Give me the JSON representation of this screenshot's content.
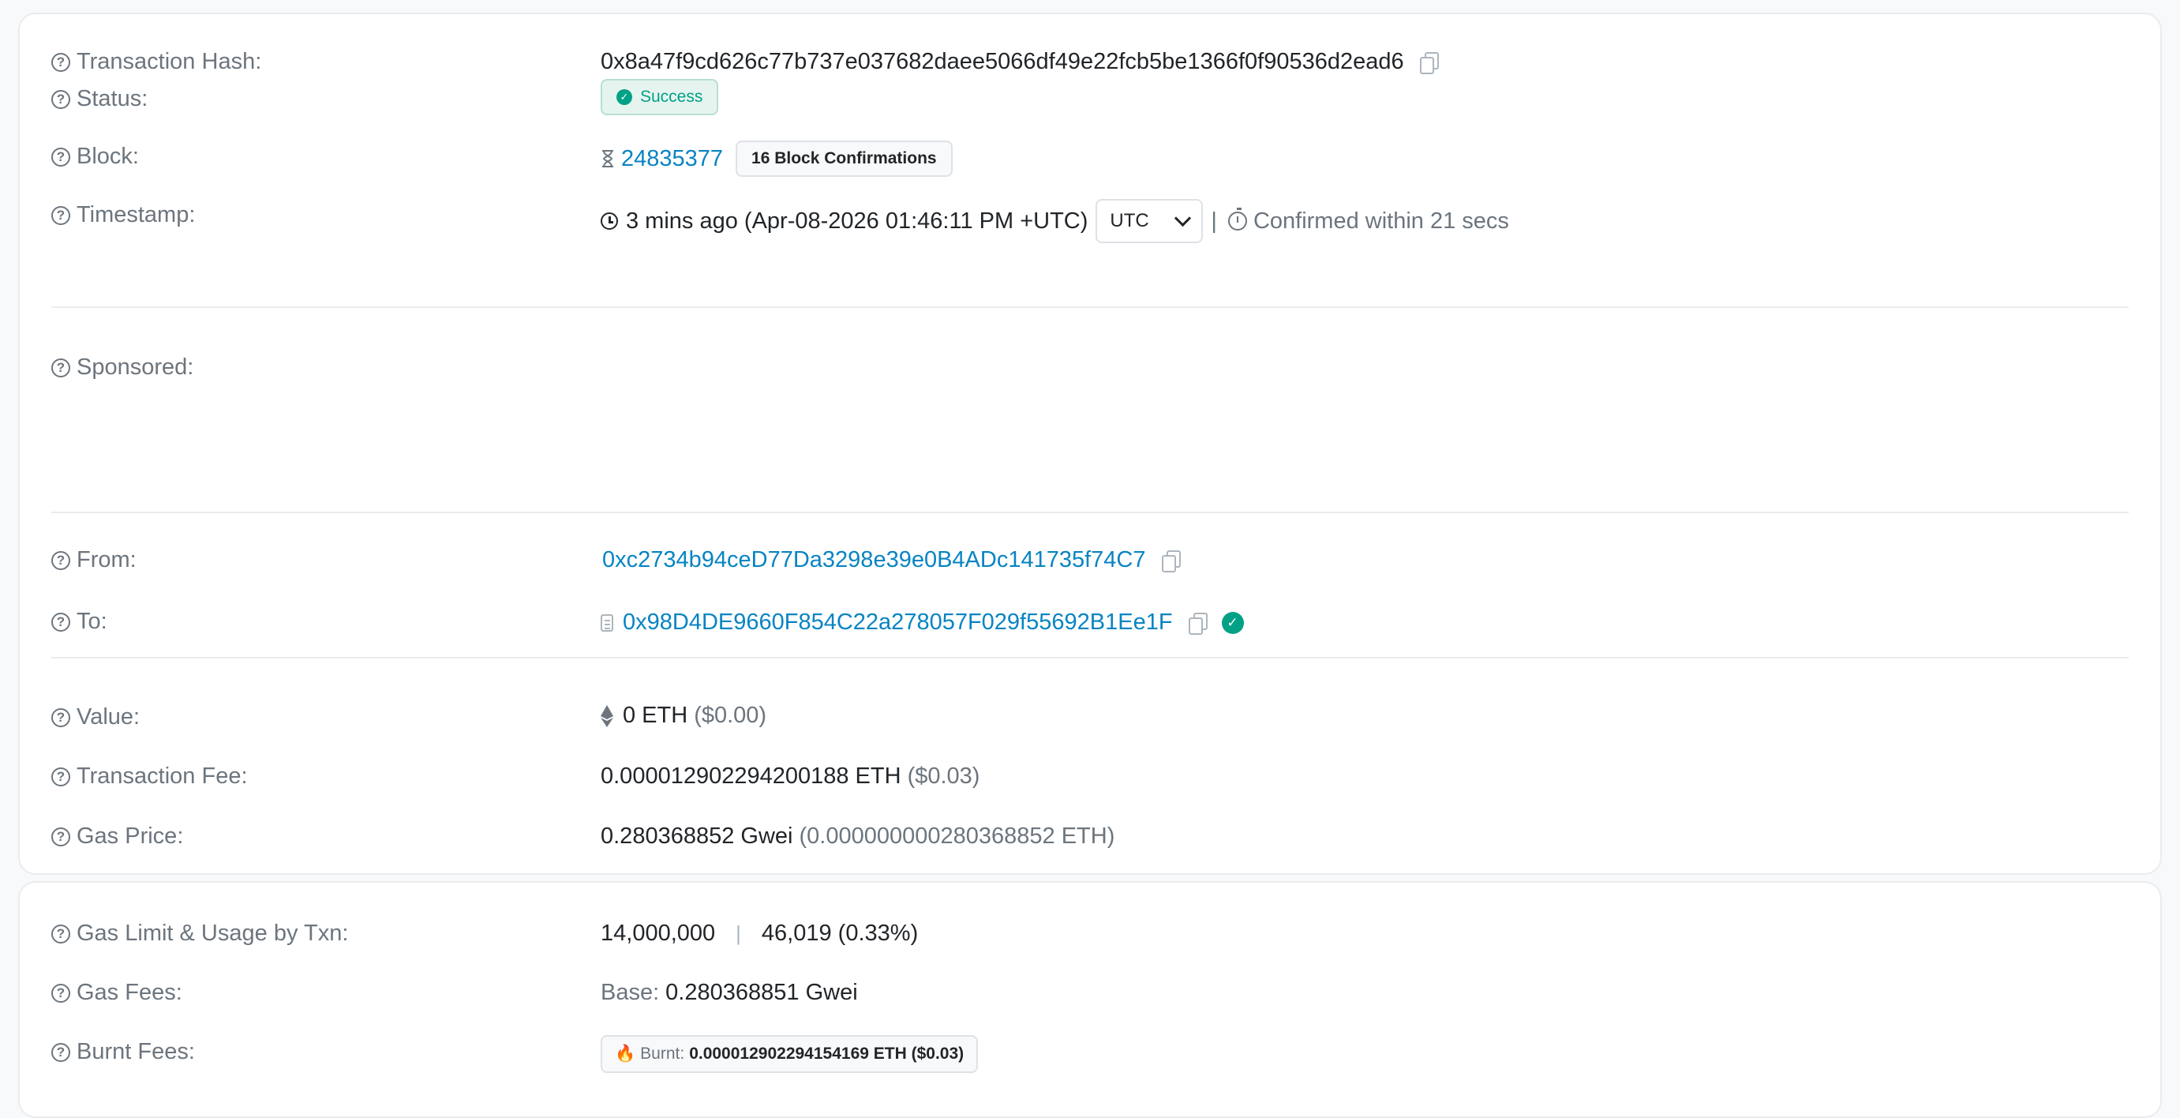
{
  "overview": {
    "tx_hash": {
      "label": "Transaction Hash:",
      "value": "0x8a47f9cd626c77b737e037682daee5066df49e22fcb5be1366f0f90536d2ead6"
    },
    "status": {
      "label": "Status:",
      "value": "Success"
    },
    "block": {
      "label": "Block:",
      "number": "24835377",
      "confirmations": "16 Block Confirmations"
    },
    "timestamp": {
      "label": "Timestamp:",
      "value": "3 mins ago (Apr-08-2026 01:46:11 PM +UTC)",
      "timezone": "UTC",
      "separator": "|",
      "confirmed": "Confirmed within 21 secs"
    },
    "sponsored": {
      "label": "Sponsored:"
    },
    "from": {
      "label": "From:",
      "address": "0xc2734b94ceD77Da3298e39e0B4ADc141735f74C7"
    },
    "to": {
      "label": "To:",
      "address": "0x98D4DE9660F854C22a278057F029f55692B1Ee1F"
    },
    "value": {
      "label": "Value:",
      "amount": "0 ETH",
      "usd": "($0.00)"
    },
    "fee": {
      "label": "Transaction Fee:",
      "amount": "0.000012902294200188 ETH",
      "usd": "($0.03)"
    },
    "gas_price": {
      "label": "Gas Price:",
      "gwei": "0.280368852 Gwei",
      "eth": "(0.000000000280368852 ETH)"
    }
  },
  "gas": {
    "limit_usage": {
      "label": "Gas Limit & Usage by Txn:",
      "limit": "14,000,000",
      "separator": "|",
      "usage": "46,019 (0.33%)"
    },
    "fees": {
      "label": "Gas Fees:",
      "base_label": "Base:",
      "base_value": "0.280368851 Gwei"
    },
    "burnt": {
      "label": "Burnt Fees:",
      "burnt_label": "Burnt:",
      "burnt_value": "0.000012902294154169 ETH ($0.03)"
    }
  },
  "colors": {
    "link": "#0784c3",
    "success": "#00a186",
    "muted": "#6c757d"
  },
  "icons": [
    "question-icon",
    "copy-icon",
    "check-circle-icon",
    "hourglass-icon",
    "clock-icon",
    "chevron-down-icon",
    "stopwatch-icon",
    "contract-icon",
    "verified-icon",
    "eth-icon",
    "fire-icon"
  ]
}
